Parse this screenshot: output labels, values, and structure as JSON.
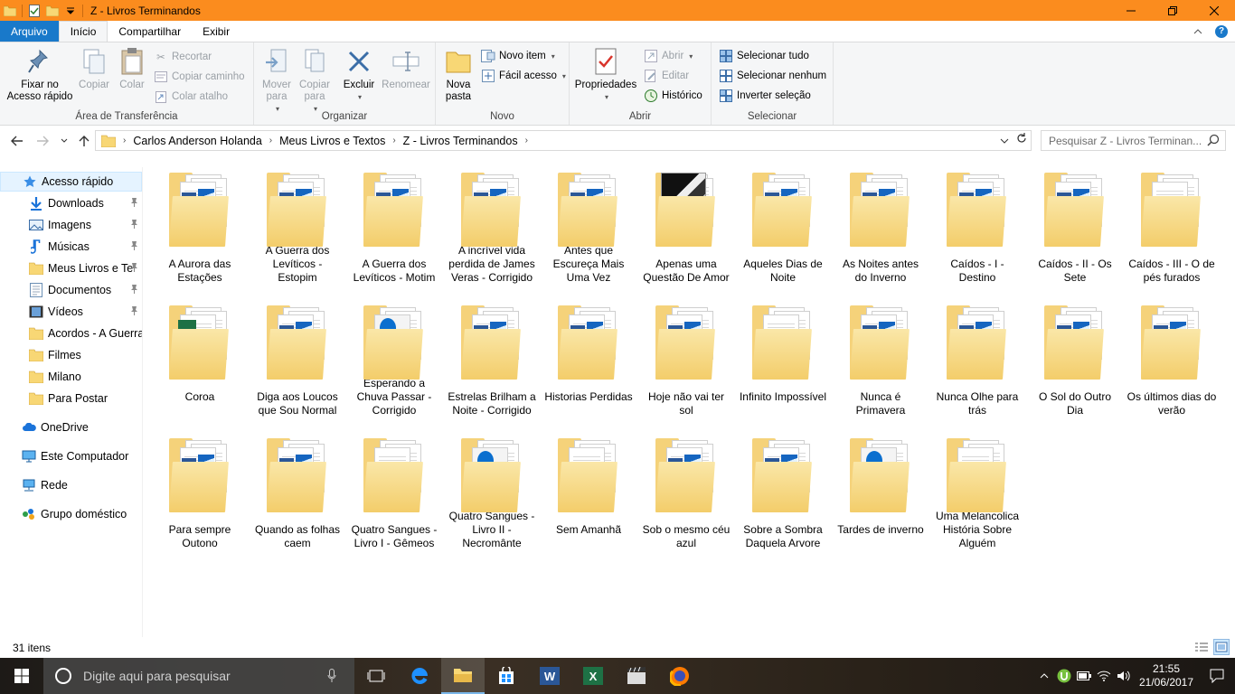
{
  "window": {
    "title": "Z - Livros Terminandos",
    "minimize_glyph": "—",
    "maximize_glyph": "❐",
    "close_glyph": "✕"
  },
  "tabs": {
    "file": "Arquivo",
    "home": "Início",
    "share": "Compartilhar",
    "view": "Exibir"
  },
  "ribbon": {
    "clipboard": {
      "label": "Área de Transferência",
      "pin": "Fixar no Acesso rápido",
      "copy": "Copiar",
      "paste": "Colar",
      "cut": "Recortar",
      "copy_path": "Copiar caminho",
      "paste_shortcut": "Colar atalho"
    },
    "organize": {
      "label": "Organizar",
      "move_to": "Mover para",
      "copy_to": "Copiar para",
      "delete": "Excluir",
      "rename": "Renomear"
    },
    "new": {
      "label": "Novo",
      "new_folder": "Nova pasta",
      "new_item": "Novo item",
      "easy_access": "Fácil acesso"
    },
    "open": {
      "label": "Abrir",
      "properties": "Propriedades",
      "open": "Abrir",
      "edit": "Editar",
      "history": "Histórico"
    },
    "select": {
      "label": "Selecionar",
      "select_all": "Selecionar tudo",
      "select_none": "Selecionar nenhum",
      "invert": "Inverter seleção"
    }
  },
  "address": {
    "crumbs": [
      "Carlos Anderson Holanda",
      "Meus Livros e Textos",
      "Z - Livros Terminandos"
    ],
    "search_placeholder": "Pesquisar Z - Livros Terminan..."
  },
  "nav": {
    "quick_access": "Acesso rápido",
    "items": [
      {
        "label": "Downloads",
        "pinned": true
      },
      {
        "label": "Imagens",
        "pinned": true
      },
      {
        "label": "Músicas",
        "pinned": true
      },
      {
        "label": "Meus Livros e Te",
        "pinned": true
      },
      {
        "label": "Documentos",
        "pinned": true
      },
      {
        "label": "Vídeos",
        "pinned": true
      },
      {
        "label": "Acordos - A Guerra",
        "pinned": false
      },
      {
        "label": "Filmes",
        "pinned": false
      },
      {
        "label": "Milano",
        "pinned": false
      },
      {
        "label": "Para Postar",
        "pinned": false
      }
    ],
    "onedrive": "OneDrive",
    "this_pc": "Este Computador",
    "network": "Rede",
    "homegroup": "Grupo doméstico"
  },
  "items": [
    {
      "label": "A Aurora das Estações",
      "kind": "word"
    },
    {
      "label": "A Guerra dos Levíticos - Estopim",
      "kind": "word"
    },
    {
      "label": "A Guerra dos Levíticos - Motim",
      "kind": "word"
    },
    {
      "label": "A incrível vida perdida de James Veras - Corrigido",
      "kind": "word"
    },
    {
      "label": "Antes que Escureça Mais Uma Vez",
      "kind": "word"
    },
    {
      "label": "Apenas uma Questão De Amor",
      "kind": "photo"
    },
    {
      "label": "Aqueles Dias de Noite",
      "kind": "word"
    },
    {
      "label": "As Noites antes do Inverno",
      "kind": "word"
    },
    {
      "label": "Caídos - I - Destino",
      "kind": "word"
    },
    {
      "label": "Caídos - II - Os Sete",
      "kind": "word"
    },
    {
      "label": "Caídos - III - O de pés furados",
      "kind": "plain"
    },
    {
      "label": "Coroa",
      "kind": "excel"
    },
    {
      "label": "Diga aos Loucos que Sou Normal",
      "kind": "word"
    },
    {
      "label": "Esperando a Chuva Passar - Corrigido",
      "kind": "pdf"
    },
    {
      "label": "Estrelas Brilham a Noite - Corrigido",
      "kind": "word"
    },
    {
      "label": "Historias Perdidas",
      "kind": "word"
    },
    {
      "label": "Hoje não vai ter sol",
      "kind": "word"
    },
    {
      "label": "Infinito Impossível",
      "kind": "plain"
    },
    {
      "label": "Nunca é Primavera",
      "kind": "word"
    },
    {
      "label": "Nunca Olhe para trás",
      "kind": "word"
    },
    {
      "label": "O Sol do Outro Dia",
      "kind": "word"
    },
    {
      "label": "Os últimos dias do verão",
      "kind": "word"
    },
    {
      "label": "Para sempre Outono",
      "kind": "word"
    },
    {
      "label": "Quando as folhas caem",
      "kind": "word"
    },
    {
      "label": "Quatro Sangues - Livro I - Gêmeos",
      "kind": "plain"
    },
    {
      "label": "Quatro Sangues - Livro II - Necromânte",
      "kind": "pdf"
    },
    {
      "label": "Sem Amanhã",
      "kind": "plain"
    },
    {
      "label": "Sob o mesmo céu azul",
      "kind": "word"
    },
    {
      "label": "Sobre a Sombra Daquela Arvore",
      "kind": "word"
    },
    {
      "label": "Tardes de inverno",
      "kind": "pdf"
    },
    {
      "label": "Uma Melancolica História Sobre Alguém",
      "kind": "plain"
    }
  ],
  "status": {
    "count": "31 itens"
  },
  "taskbar": {
    "search_placeholder": "Digite aqui para pesquisar",
    "time": "21:55",
    "date": "21/06/2017"
  },
  "colors": {
    "title_bar": "#fb8c1e",
    "file_tab": "#1979ca",
    "folder": "#f5d27a"
  }
}
